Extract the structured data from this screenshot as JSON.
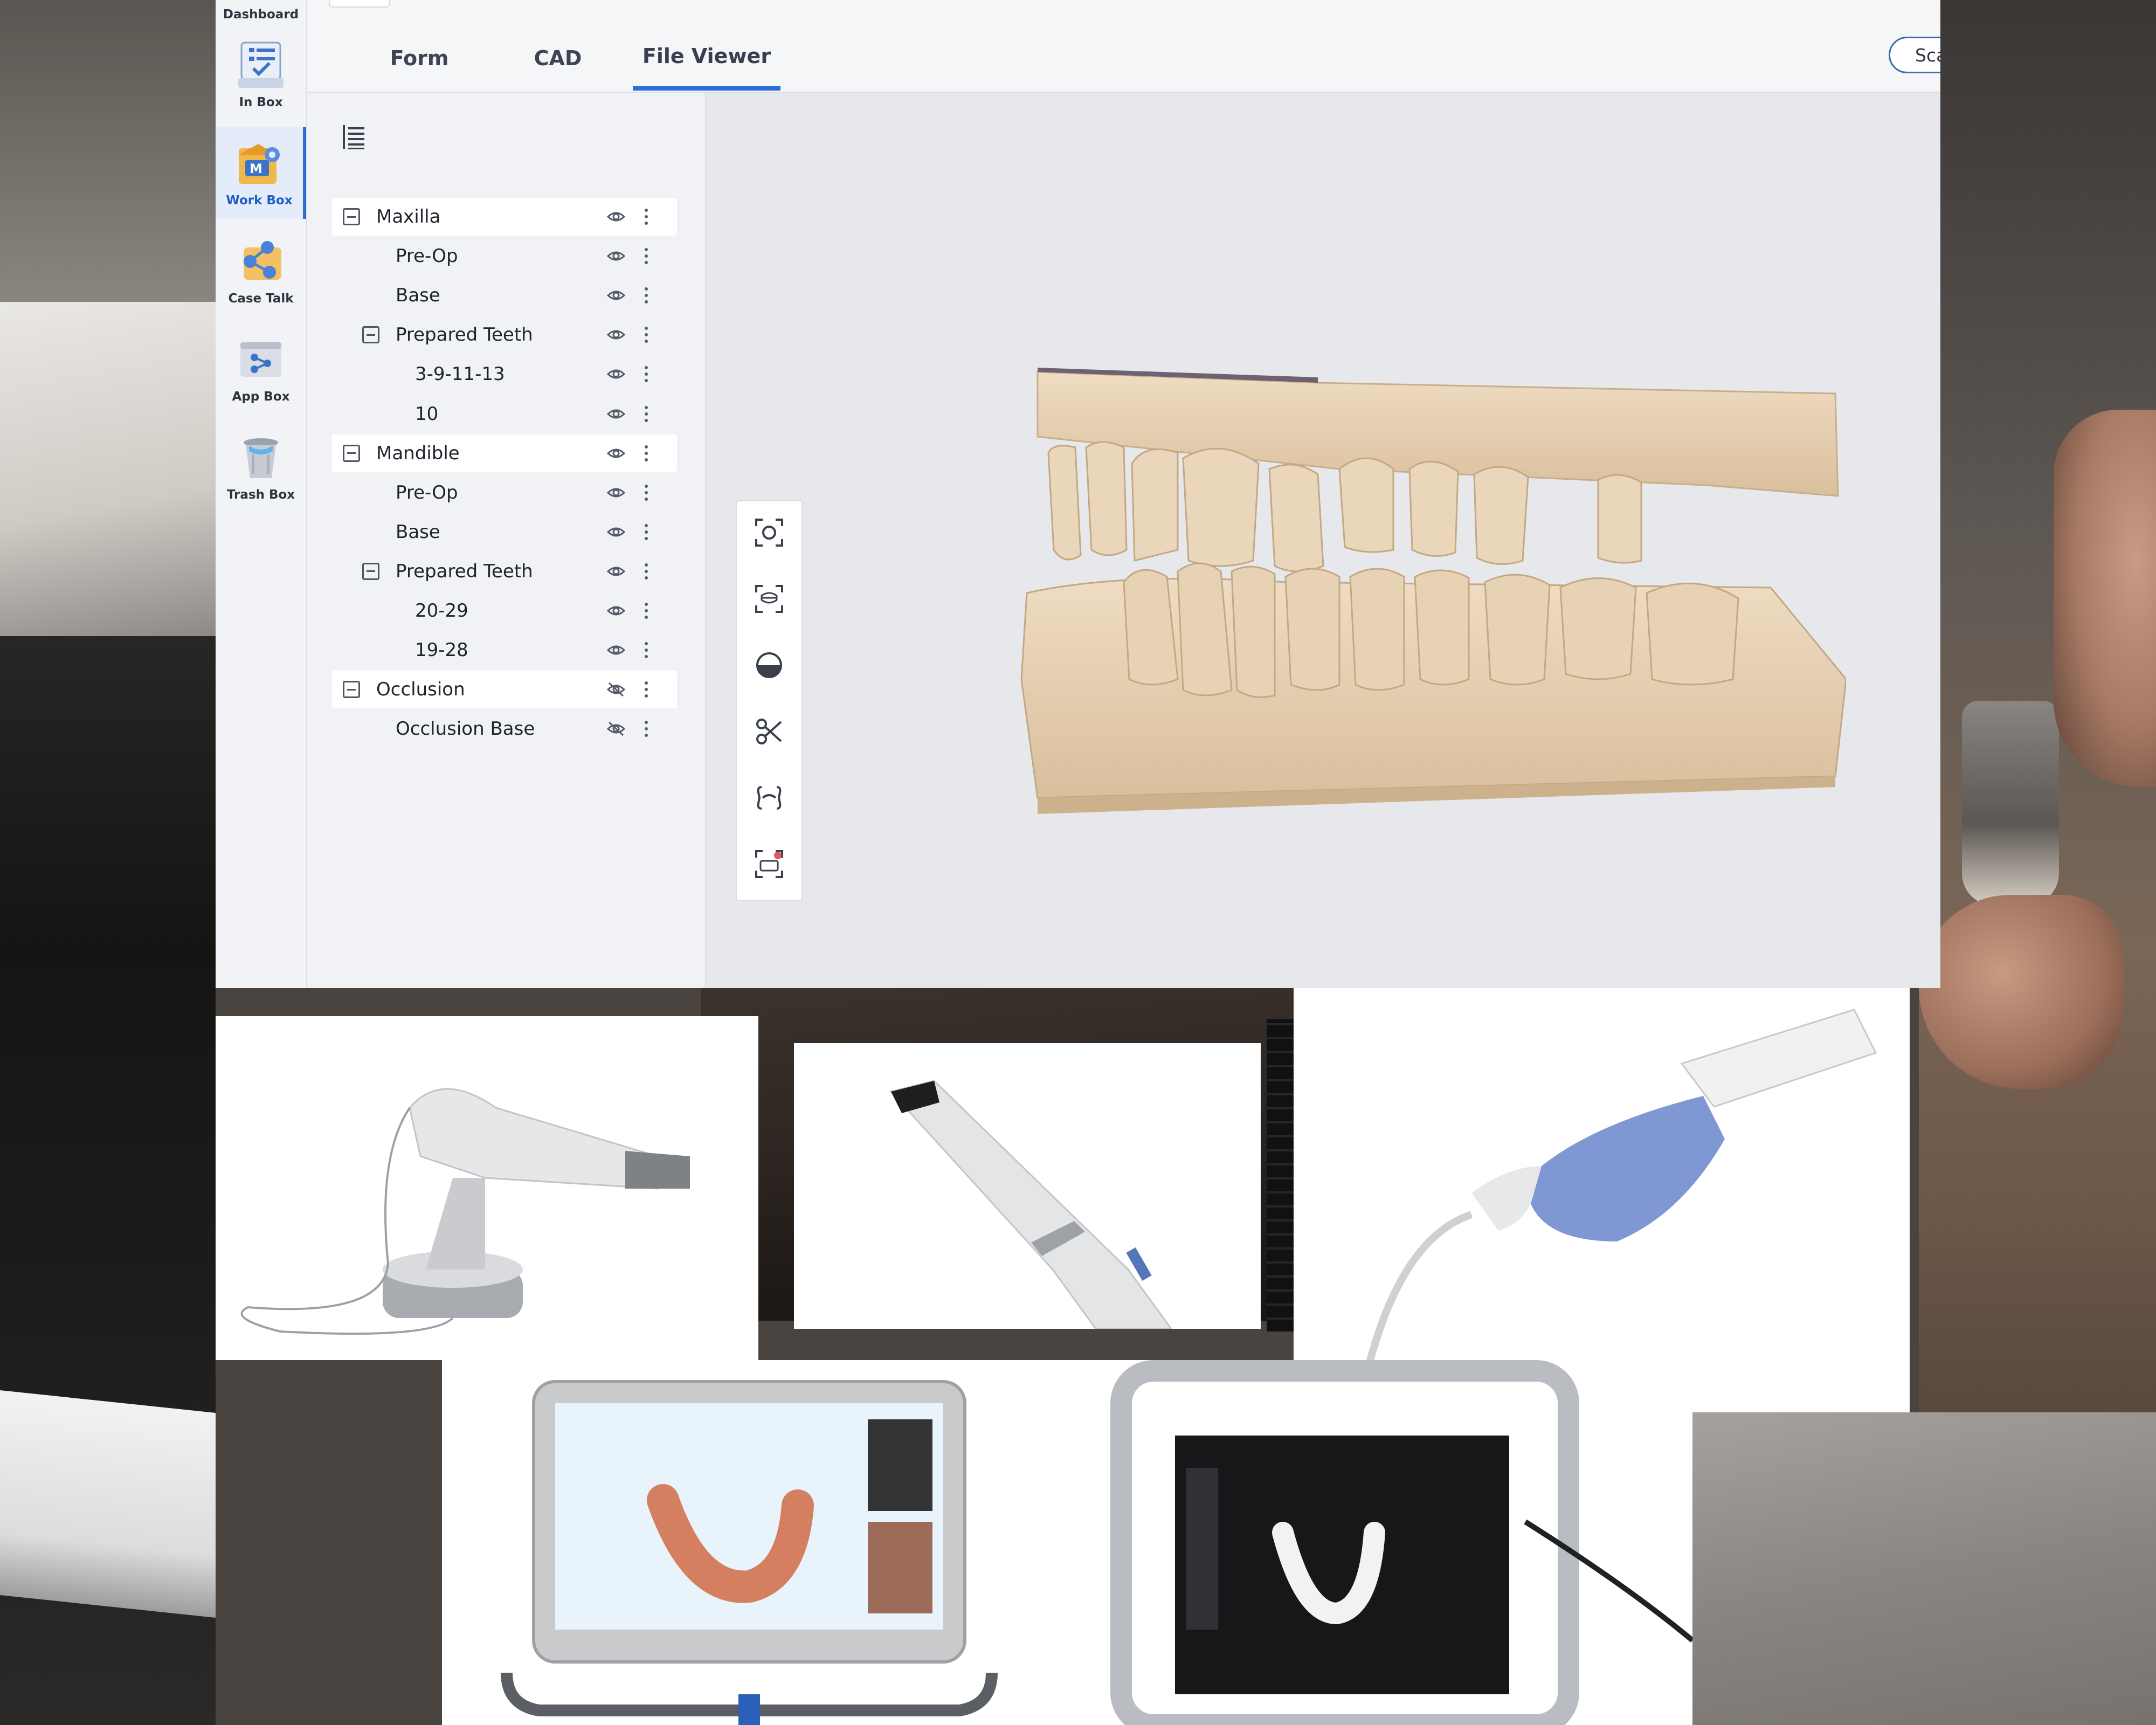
{
  "sidebar": {
    "items": [
      {
        "label": "Dashboard",
        "icon": "dashboard-icon"
      },
      {
        "label": "In Box",
        "icon": "inbox-icon"
      },
      {
        "label": "Work Box",
        "icon": "workbox-icon",
        "active": true
      },
      {
        "label": "Case Talk",
        "icon": "case-talk-icon"
      },
      {
        "label": "App Box",
        "icon": "app-box-icon"
      },
      {
        "label": "Trash Box",
        "icon": "trash-box-icon"
      }
    ]
  },
  "tabs": [
    {
      "label": "Form"
    },
    {
      "label": "CAD"
    },
    {
      "label": "File Viewer",
      "active": true
    }
  ],
  "header": {
    "scan_button_label": "Scan Complete"
  },
  "tree": [
    {
      "label": "Maxilla",
      "level": 0,
      "group": true,
      "visible": true
    },
    {
      "label": "Pre-Op",
      "level": 1,
      "visible": true
    },
    {
      "label": "Base",
      "level": 1,
      "visible": true
    },
    {
      "label": "Prepared Teeth",
      "level": 1,
      "group": true,
      "visible": true
    },
    {
      "label": "3-9-11-13",
      "level": 2,
      "visible": true
    },
    {
      "label": "10",
      "level": 2,
      "visible": true
    },
    {
      "label": "Mandible",
      "level": 0,
      "group": true,
      "visible": true
    },
    {
      "label": "Pre-Op",
      "level": 1,
      "visible": true
    },
    {
      "label": "Base",
      "level": 1,
      "visible": true
    },
    {
      "label": "Prepared Teeth",
      "level": 1,
      "group": true,
      "visible": true
    },
    {
      "label": "20-29",
      "level": 2,
      "visible": true
    },
    {
      "label": "19-28",
      "level": 2,
      "visible": true
    },
    {
      "label": "Occlusion",
      "level": 0,
      "group": true,
      "visible": false
    },
    {
      "label": "Occlusion Base",
      "level": 1,
      "visible": false
    }
  ],
  "viewer_tools": [
    "fit-view-icon",
    "front-view-icon",
    "clipping-icon",
    "scissors-icon",
    "bite-icon",
    "snapshot-icon"
  ],
  "colors": {
    "accent": "#2a6fd6",
    "model": "#ecd5b8",
    "panel": "#f1f2f5",
    "viewer_bg": "#e6e8ec"
  }
}
